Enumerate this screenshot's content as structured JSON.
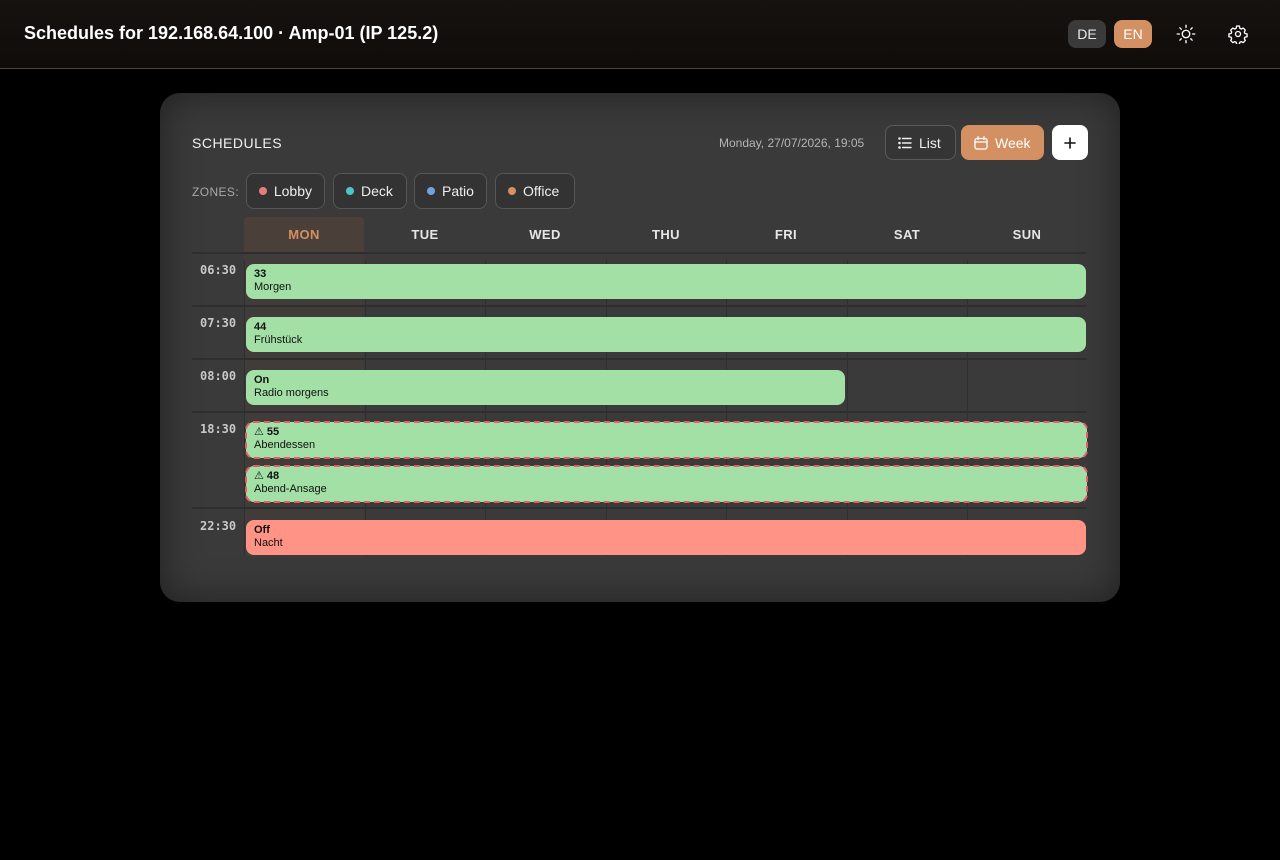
{
  "header": {
    "title": "Schedules for 192.168.64.100 · Amp-01 (IP 125.2)",
    "lang_de": "DE",
    "lang_en": "EN",
    "active_lang": "EN",
    "theme_icon": "sun-icon",
    "settings_icon": "gear-icon"
  },
  "card": {
    "title": "SCHEDULES",
    "datetime": "Monday, 27/07/2026, 19:05",
    "list_label": "List",
    "week_label": "Week",
    "active_view": "Week",
    "add_icon": "plus-icon"
  },
  "zones": {
    "label": "ZONES:",
    "items": [
      {
        "name": "Lobby",
        "color": "#e27d7d"
      },
      {
        "name": "Deck",
        "color": "#4cc6c9"
      },
      {
        "name": "Patio",
        "color": "#6fa3e0"
      },
      {
        "name": "Office",
        "color": "#d39062"
      }
    ]
  },
  "days": [
    "MON",
    "TUE",
    "WED",
    "THU",
    "FRI",
    "SAT",
    "SUN"
  ],
  "today": "MON",
  "rows": [
    {
      "time": "06:30",
      "events": [
        {
          "value": "33",
          "name": "Morgen",
          "color": "green",
          "warning": false,
          "days": "MON-SUN"
        }
      ]
    },
    {
      "time": "07:30",
      "events": [
        {
          "value": "44",
          "name": "Frühstück",
          "color": "green",
          "warning": false,
          "days": "MON-SUN"
        }
      ]
    },
    {
      "time": "08:00",
      "events": [
        {
          "value": "On",
          "name": "Radio morgens",
          "color": "green",
          "warning": false,
          "days": "MON-FRI"
        }
      ]
    },
    {
      "time": "18:30",
      "events": [
        {
          "value": "⚠ 55",
          "name": "Abendessen",
          "color": "green",
          "warning": true,
          "days": "MON-SUN"
        },
        {
          "value": "⚠ 48",
          "name": "Abend-Ansage",
          "color": "green",
          "warning": true,
          "days": "MON-SUN"
        }
      ]
    },
    {
      "time": "22:30",
      "events": [
        {
          "value": "Off",
          "name": "Nacht",
          "color": "red",
          "warning": false,
          "days": "MON-SUN"
        }
      ]
    }
  ]
}
